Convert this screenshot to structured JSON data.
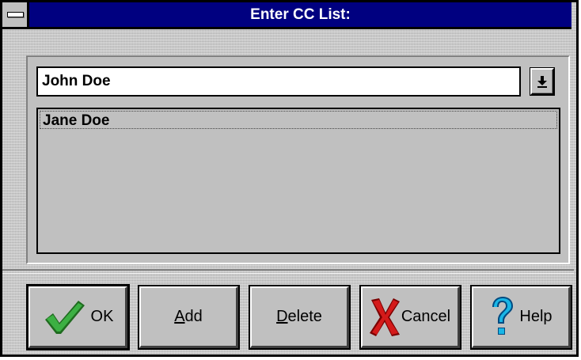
{
  "window": {
    "title": "Enter CC List:"
  },
  "combo": {
    "value": "John Doe",
    "dropdown_icon": "down-arrow-bar-icon"
  },
  "cc_list": {
    "items": [
      "Jane Doe"
    ]
  },
  "buttons": {
    "ok": {
      "label": "OK",
      "icon": "green-check-icon"
    },
    "add": {
      "label": "Add",
      "mnemonic": "A"
    },
    "delete": {
      "label": "Delete",
      "mnemonic": "D"
    },
    "cancel": {
      "label": "Cancel",
      "icon": "red-x-icon"
    },
    "help": {
      "label": "Help",
      "icon": "question-mark-icon"
    }
  },
  "colors": {
    "title_bar": "#000080",
    "face": "#c0c0c0",
    "check": "#2e8b2e",
    "cross": "#c00000",
    "question": "#00a0c0"
  }
}
